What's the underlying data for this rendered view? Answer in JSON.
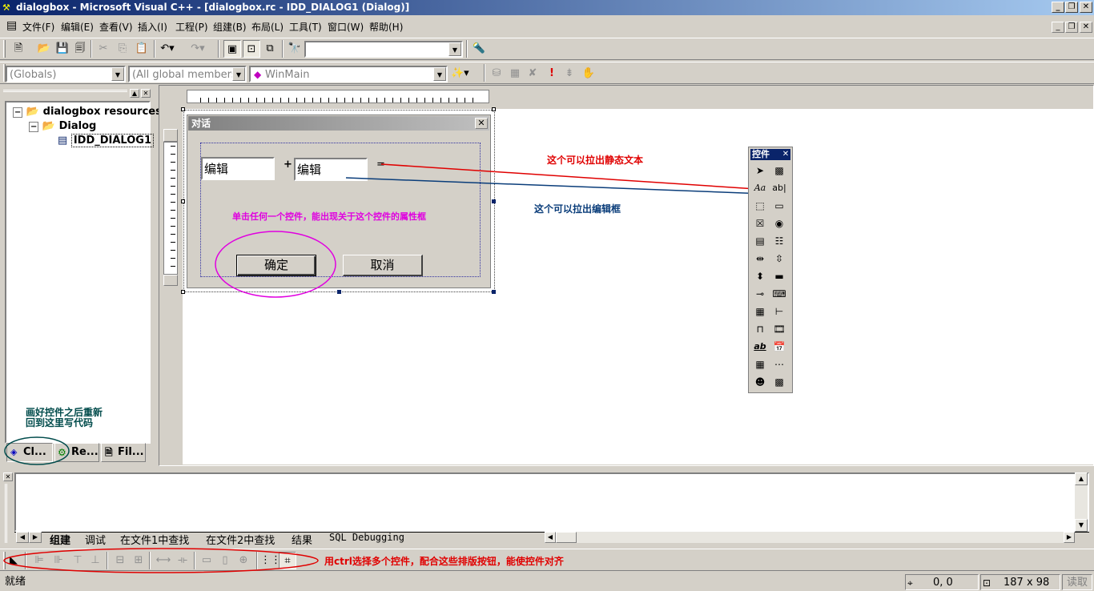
{
  "window": {
    "title": "dialogbox - Microsoft Visual C++ - [dialogbox.rc - IDD_DIALOG1 (Dialog)]"
  },
  "menu": [
    "文件(F)",
    "编辑(E)",
    "查看(V)",
    "插入(I)",
    "工程(P)",
    "组建(B)",
    "布局(L)",
    "工具(T)",
    "窗口(W)",
    "帮助(H)"
  ],
  "toolbar": {
    "find_combo_value": "",
    "globals_combo": "(Globals)",
    "members_combo": "(All global members",
    "function_combo": "WinMain"
  },
  "workspace": {
    "tree": {
      "root": "dialogbox resources",
      "folder": "Dialog",
      "item": "IDD_DIALOG1"
    },
    "tabs": [
      "Cl...",
      "Re...",
      "Fil..."
    ],
    "note_line1": "画好控件之后重新",
    "note_line2": "回到这里写代码"
  },
  "dialog": {
    "title": "对话",
    "close": "✕",
    "edit1": "编辑",
    "plus": "+",
    "edit2": "编辑",
    "equals": "=",
    "ok": "确定",
    "cancel": "取消",
    "note": "单击任何一个控件，能出现关于这个控件的属性框"
  },
  "palette": {
    "title": "控件",
    "close": "✕"
  },
  "annotations": {
    "static_text": "这个可以拉出静态文本",
    "edit_box": "这个可以拉出编辑框",
    "layout_note": "用ctrl选择多个控件，配合这些排版按钮，能使控件对齐"
  },
  "output": {
    "tabs": [
      "组建",
      "调试",
      "在文件1中查找",
      "在文件2中查找",
      "结果",
      "SQL Debugging"
    ]
  },
  "status": {
    "ready": "就绪",
    "position": "0, 0",
    "size": "187 x 98",
    "readonly": "读取"
  },
  "colors": {
    "annotation_red": "#e00000",
    "annotation_blue": "#0a3d7a",
    "annotation_magenta": "#e000e0",
    "annotation_green": "#004b4b"
  }
}
